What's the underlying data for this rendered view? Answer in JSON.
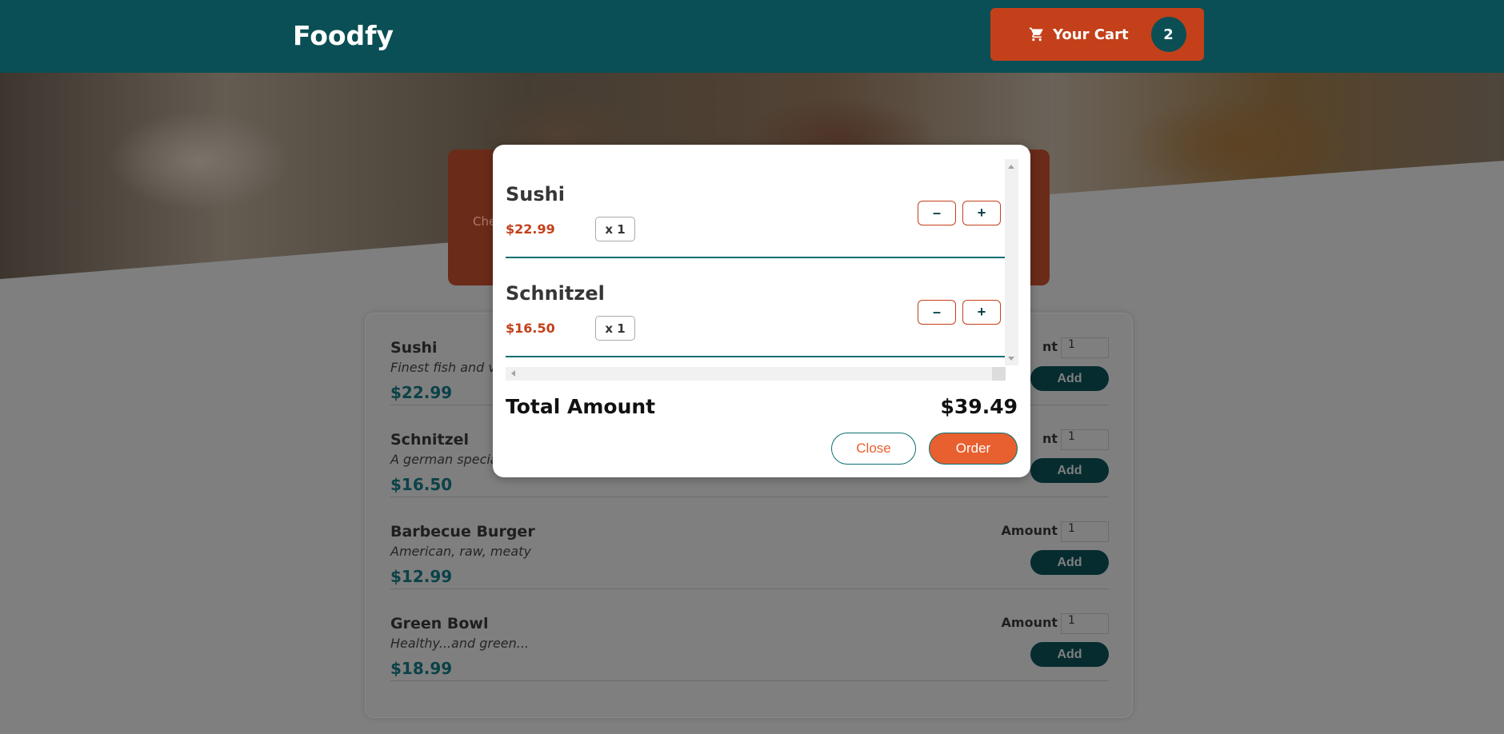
{
  "header": {
    "brand": "Foodfy",
    "cart_label": "Your Cart",
    "cart_count": "2",
    "cart_icon": "cart-icon"
  },
  "intro": {
    "text_fragment": "Che"
  },
  "meals": [
    {
      "name": "Sushi",
      "description": "Finest fish and ve",
      "price": "$22.99",
      "amount_label": "nt",
      "amount_value": "1",
      "add_label": "Add"
    },
    {
      "name": "Schnitzel",
      "description": "A german specia",
      "price": "$16.50",
      "amount_label": "nt",
      "amount_value": "1",
      "add_label": "Add"
    },
    {
      "name": "Barbecue Burger",
      "description": "American, raw, meaty",
      "price": "$12.99",
      "amount_label": "Amount",
      "amount_value": "1",
      "add_label": "Add"
    },
    {
      "name": "Green Bowl",
      "description": "Healthy...and green...",
      "price": "$18.99",
      "amount_label": "Amount",
      "amount_value": "1",
      "add_label": "Add"
    }
  ],
  "modal": {
    "items": [
      {
        "name": "Sushi",
        "price": "$22.99",
        "quantity": "x 1",
        "minus": "–",
        "plus": "+"
      },
      {
        "name": "Schnitzel",
        "price": "$16.50",
        "quantity": "x 1",
        "minus": "–",
        "plus": "+"
      }
    ],
    "total_label": "Total Amount",
    "total_value": "$39.49",
    "close_label": "Close",
    "order_label": "Order"
  },
  "colors": {
    "header": "#0a4f55",
    "accent": "#e8602f",
    "cart_button": "#c3401a",
    "teal_dark": "#0b4248"
  }
}
